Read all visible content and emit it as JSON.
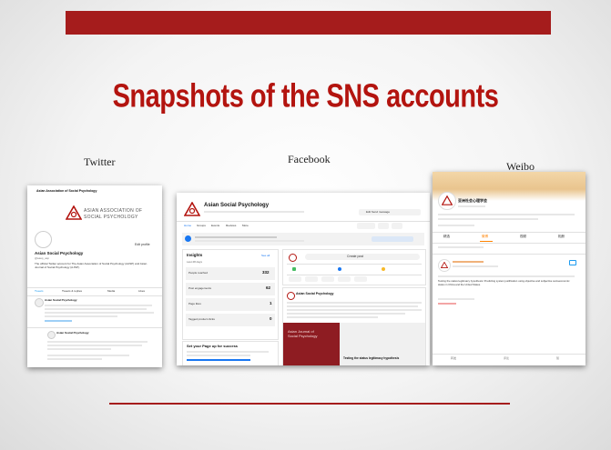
{
  "slide": {
    "title": "Snapshots of the SNS accounts",
    "colors": {
      "accent": "#a51c1c",
      "title": "#b3140f"
    }
  },
  "labels": {
    "twitter": "Twitter",
    "facebook": "Facebook",
    "weibo": "Weibo"
  },
  "twitter": {
    "header_name": "Asian Association of Social Psychology",
    "org_line1": "ASIAN ASSOCIATION OF",
    "org_line2": "SOCIAL PSYCHOLOGY",
    "edit_button": "Edit profile",
    "name": "Asian Social Psychology",
    "handle": "@aasp_asp",
    "bio": "The official Twitter account for The Asian Association of Social Psychology (AASP) and Asian Journal of Social Psychology (AJSP).",
    "tabs": [
      "Tweets",
      "Tweets & replies",
      "Media",
      "Likes"
    ],
    "tweet_author": "Asian Social Psychology"
  },
  "facebook": {
    "page_name": "Asian Social Psychology",
    "edit_button": "Edit Send message",
    "nav": [
      "Home",
      "Groups",
      "Events",
      "Reviews",
      "More"
    ],
    "insights_title": "Insights",
    "insights_link": "See all",
    "insights_period": "Last 28 days",
    "metrics": [
      {
        "label": "People reached",
        "value": "332"
      },
      {
        "label": "Post engagements",
        "value": "62"
      },
      {
        "label": "Page likes",
        "value": "1"
      },
      {
        "label": "Tagged product clicks",
        "value": "0"
      }
    ],
    "setup_title": "Set your Page up for success",
    "create_post": "Create post",
    "post_author": "Asian Social Psychology",
    "post_image_text": "Asian Journal of Social Psychology",
    "post_link_title": "Testing the status legitimacy hypothesis"
  },
  "weibo": {
    "profile_name": "亚洲社会心理学会",
    "tabs": [
      "精选",
      "微博",
      "视频",
      "相册"
    ],
    "post_text": "Testing the status legitimacy hypothesis: Predicting system justification using objective and subjective socioeconomic status in China and the United States.",
    "footer": [
      "转发",
      "评论",
      "赞"
    ]
  }
}
